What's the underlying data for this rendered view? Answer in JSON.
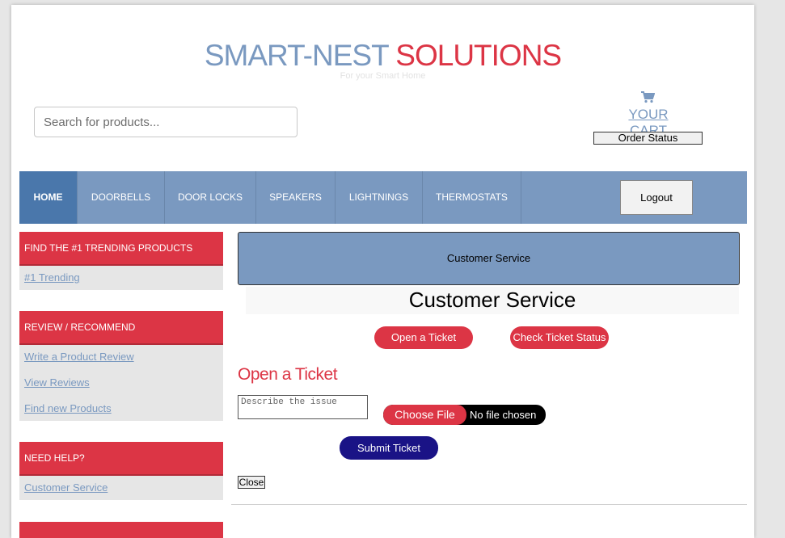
{
  "header": {
    "brand_part1": "SMART-NEST",
    "brand_part2": "SOLUTIONS",
    "tagline": "For your Smart Home",
    "search_placeholder": "Search for products...",
    "cart_label": "YOUR CART",
    "cart_icon": "shopping-cart-icon",
    "order_status_label": "Order Status"
  },
  "nav": {
    "items": [
      {
        "label": "HOME",
        "active": true
      },
      {
        "label": "DOORBELLS"
      },
      {
        "label": "DOOR LOCKS"
      },
      {
        "label": "SPEAKERS"
      },
      {
        "label": "LIGHTNINGS"
      },
      {
        "label": "THERMOSTATS"
      }
    ],
    "logout_label": "Logout"
  },
  "sidebar": {
    "sections": [
      {
        "heading": "FIND THE #1 TRENDING PRODUCTS",
        "links": [
          "#1 Trending"
        ]
      },
      {
        "heading": "REVIEW / RECOMMEND",
        "links": [
          "Write a Product Review",
          "View Reviews",
          "Find new Products"
        ]
      },
      {
        "heading": "NEED HELP?",
        "links": [
          "Customer Service"
        ]
      }
    ]
  },
  "main": {
    "banner": "Customer Service",
    "title": "Customer Service",
    "open_ticket_button": "Open a Ticket",
    "check_status_button": "Check Ticket Status",
    "form_heading": "Open a Ticket",
    "issue_placeholder": "Describe the issue",
    "file_button": "Choose File",
    "file_status": "No file chosen",
    "submit_label": "Submit Ticket",
    "close_label": "Close"
  },
  "colors": {
    "brand_blue": "#7a99c0",
    "brand_red": "#dc3545",
    "nav_active": "#4a77ab",
    "submit_navy": "#1a1386"
  }
}
